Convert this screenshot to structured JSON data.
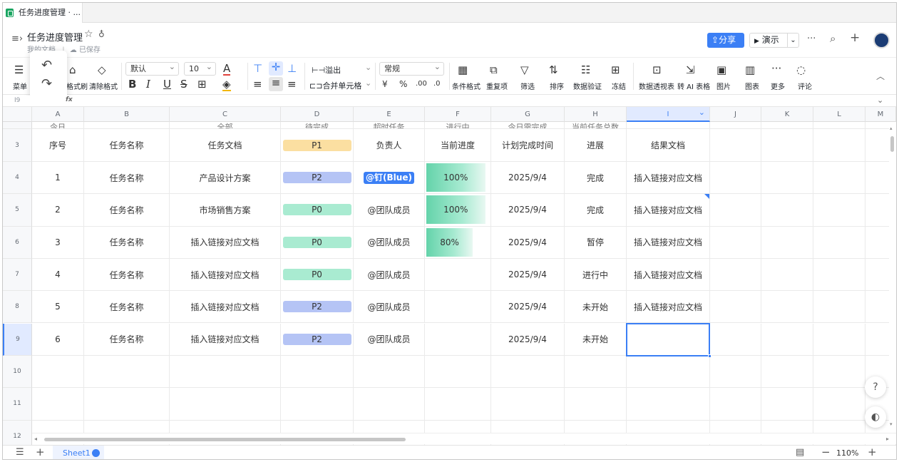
{
  "tab": {
    "title": "任务进度管理 · ..."
  },
  "doc": {
    "title": "任务进度管理",
    "location": "我的文档",
    "saved": "已保存"
  },
  "header": {
    "share": "分享",
    "present": "演示",
    "more": "···"
  },
  "toolbar": {
    "menu": "菜单",
    "format_painter": "格式刷",
    "clear_format": "清除格式",
    "font": "默认",
    "size": "10",
    "overflow": "溢出",
    "merge": "合并单元格",
    "number_format": "常规",
    "currency": "¥",
    "percent": "%",
    "cond_format": "条件格式",
    "duplicates": "重复项",
    "filter": "筛选",
    "sort": "排序",
    "validation": "数据验证",
    "freeze": "冻结",
    "pivot": "数据透视表",
    "ai_table": "转 AI 表格",
    "image": "图片",
    "chart": "图表",
    "more": "更多",
    "comment": "评论"
  },
  "formula": {
    "cell_ref": "I9",
    "fx": "fx"
  },
  "columns": [
    "A",
    "B",
    "C",
    "D",
    "E",
    "F",
    "G",
    "H",
    "I",
    "J",
    "K",
    "L",
    "M"
  ],
  "row2_partial": {
    "A": "今日",
    "C": "全部",
    "D": "待完成",
    "E": "超时任务",
    "F": "进行中",
    "G": "今日需完成",
    "H": "当前任务总数"
  },
  "header_row": {
    "num": "3",
    "A": "序号",
    "B": "任务名称",
    "C": "任务文档",
    "D": "P1",
    "E": "负责人",
    "F": "当前进度",
    "G": "计划完成时间",
    "H": "进展",
    "I": "结果文档"
  },
  "rows": [
    {
      "num": "4",
      "A": "1",
      "B": "任务名称",
      "C": "产品设计方案",
      "D": "P2",
      "E": "@钉(Blue)",
      "F": "100%",
      "G": "2025/9/4",
      "H": "完成",
      "I": "插入链接对应文档"
    },
    {
      "num": "5",
      "A": "2",
      "B": "任务名称",
      "C": "市场销售方案",
      "D": "P0",
      "E": "@团队成员",
      "F": "100%",
      "G": "2025/9/4",
      "H": "完成",
      "I": "插入链接对应文档"
    },
    {
      "num": "6",
      "A": "3",
      "B": "任务名称",
      "C": "插入链接对应文档",
      "D": "P0",
      "E": "@团队成员",
      "F": "80%",
      "G": "2025/9/4",
      "H": "暂停",
      "I": "插入链接对应文档"
    },
    {
      "num": "7",
      "A": "4",
      "B": "任务名称",
      "C": "插入链接对应文档",
      "D": "P0",
      "E": "@团队成员",
      "F": "",
      "G": "2025/9/4",
      "H": "进行中",
      "I": "插入链接对应文档"
    },
    {
      "num": "8",
      "A": "5",
      "B": "任务名称",
      "C": "插入链接对应文档",
      "D": "P2",
      "E": "@团队成员",
      "F": "",
      "G": "2025/9/4",
      "H": "未开始",
      "I": "插入链接对应文档"
    },
    {
      "num": "9",
      "A": "6",
      "B": "任务名称",
      "C": "插入链接对应文档",
      "D": "P2",
      "E": "@团队成员",
      "F": "",
      "G": "2025/9/4",
      "H": "未开始",
      "I": ""
    }
  ],
  "progress_levels": [
    1.0,
    1.0,
    0.8
  ],
  "empty_rows": [
    "10",
    "11",
    "12"
  ],
  "status": {
    "sheet": "Sheet1",
    "zoom": "110%"
  },
  "colors": {
    "accent": "#3b7ff5",
    "p0": "#a9ebd1",
    "p1": "#fbdfa1",
    "p2": "#b5c4f5",
    "progress": "#64d3aa"
  }
}
